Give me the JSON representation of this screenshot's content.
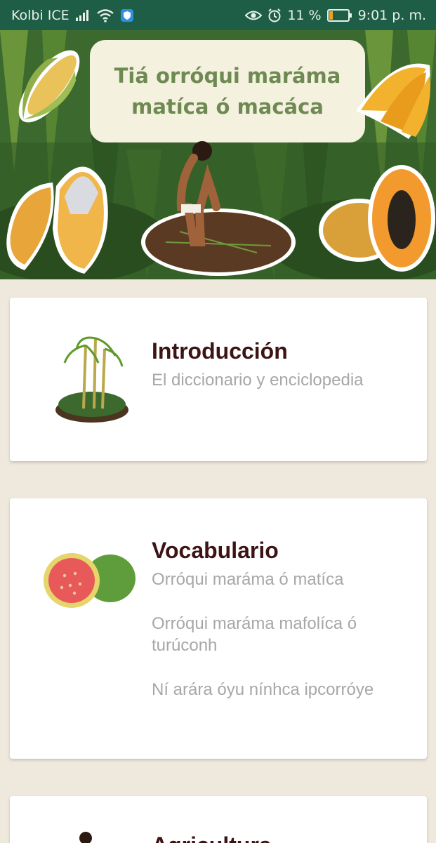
{
  "status_bar": {
    "carrier": "Kolbi ICE",
    "battery": "11 %",
    "time": "9:01 p. m.",
    "icons": [
      "signal-icon",
      "wifi-icon",
      "shield-icon",
      "eye-icon",
      "alarm-icon",
      "battery-icon"
    ],
    "background": "#1e5e46"
  },
  "banner": {
    "title_line1": "Tiá orróqui maráma",
    "title_line2": "matíca ó macáca",
    "illustrations": [
      "corn-icon",
      "cacao-icon",
      "farmer-icon",
      "bananas-icon",
      "papaya-icon"
    ]
  },
  "cards": [
    {
      "title": "Introducción",
      "lines": [
        "El diccionario y enciclopedia"
      ],
      "illustration": "sugarcane-icon"
    },
    {
      "title": "Vocabulario",
      "lines": [
        "Orróqui maráma ó matíca",
        "Orróqui maráma mafolíca ó turúconh",
        "Ní arára óyu nínhca ipcorróye"
      ],
      "illustration": "guava-icon"
    },
    {
      "title": "Agricultura",
      "illustration": "farmer-icon"
    }
  ],
  "colors": {
    "title_text": "#3d1414",
    "subtitle_text": "#a7a7a7",
    "page_background": "#efe9dd"
  }
}
